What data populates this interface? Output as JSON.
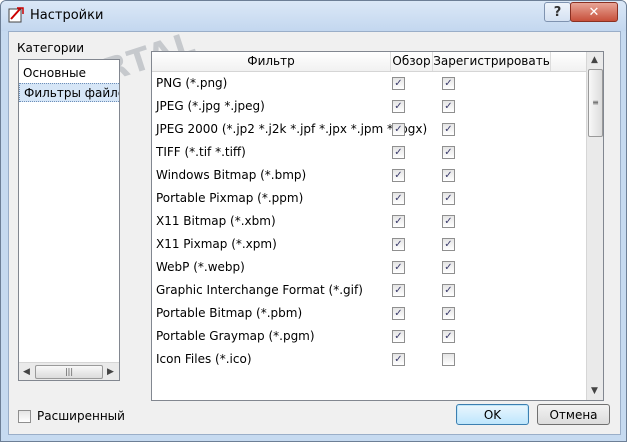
{
  "window": {
    "title": "Настройки",
    "help_glyph": "?",
    "close_glyph": "✕",
    "watermark": "PORTAL"
  },
  "categories": {
    "label": "Категории",
    "items": [
      "Основные",
      "Фильтры файлов"
    ],
    "selected_index": 1
  },
  "table": {
    "headers": {
      "filter": "Фильтр",
      "browse": "Обзор",
      "register": "Зарегистрировать"
    },
    "rows": [
      {
        "name": "PNG (*.png)",
        "browse": true,
        "register": true
      },
      {
        "name": "JPEG (*.jpg *.jpeg)",
        "browse": true,
        "register": true
      },
      {
        "name": "JPEG 2000 (*.jp2 *.j2k *.jpf *.jpx *.jpm *.jpgx)",
        "browse": true,
        "register": true
      },
      {
        "name": "TIFF (*.tif *.tiff)",
        "browse": true,
        "register": true
      },
      {
        "name": "Windows Bitmap (*.bmp)",
        "browse": true,
        "register": true
      },
      {
        "name": "Portable Pixmap (*.ppm)",
        "browse": true,
        "register": true
      },
      {
        "name": "X11 Bitmap (*.xbm)",
        "browse": true,
        "register": true
      },
      {
        "name": "X11 Pixmap (*.xpm)",
        "browse": true,
        "register": true
      },
      {
        "name": "WebP (*.webp)",
        "browse": true,
        "register": true
      },
      {
        "name": "Graphic Interchange Format (*.gif)",
        "browse": true,
        "register": true
      },
      {
        "name": "Portable Bitmap (*.pbm)",
        "browse": true,
        "register": true
      },
      {
        "name": "Portable Graymap (*.pgm)",
        "browse": true,
        "register": true
      },
      {
        "name": "Icon Files (*.ico)",
        "browse": true,
        "register": false
      }
    ]
  },
  "footer": {
    "advanced_label": "Расширенный",
    "advanced_checked": false,
    "ok_label": "OK",
    "cancel_label": "Отмена"
  }
}
